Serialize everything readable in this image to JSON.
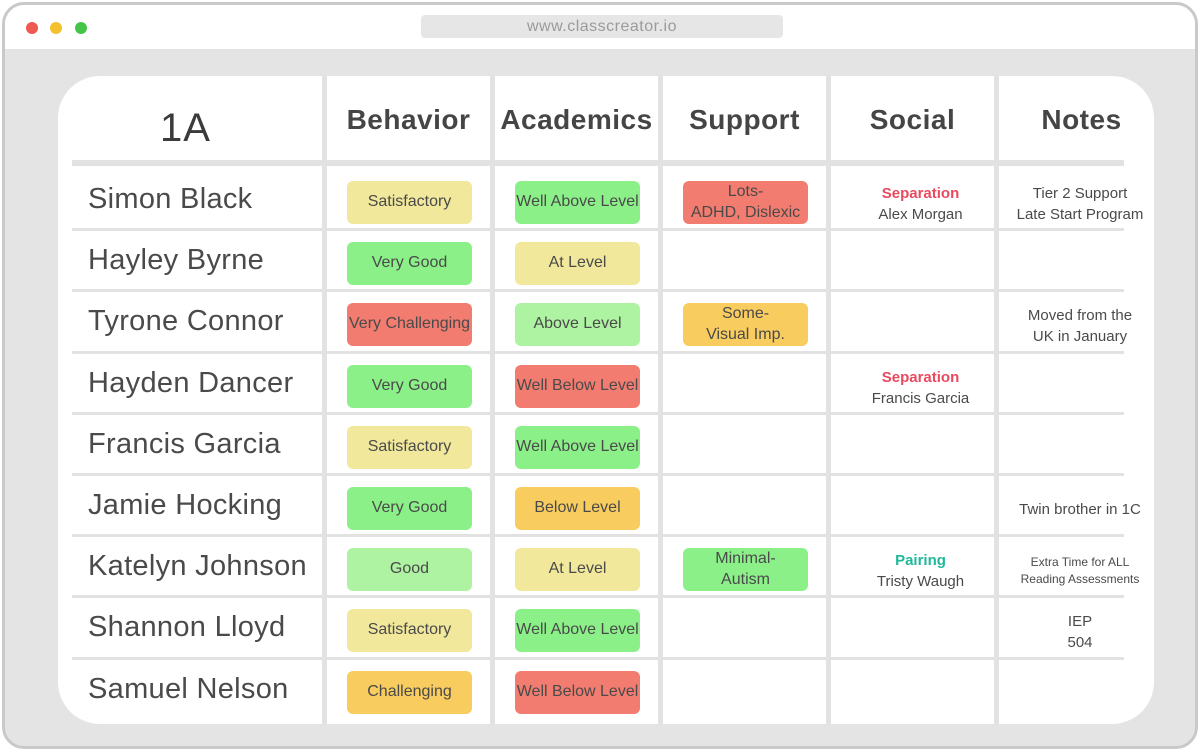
{
  "browser": {
    "url": "www.classcreator.io"
  },
  "colors": {
    "green": "#8bf088",
    "light_green": "#aef3a2",
    "yellow": "#f1e89c",
    "orange": "#f8cc5e",
    "red": "#f27c6f",
    "separation": "#e84a5f",
    "pairing": "#1fb89a"
  },
  "table": {
    "class_name": "1A",
    "headers": {
      "behavior": "Behavior",
      "academics": "Academics",
      "support": "Support",
      "social": "Social",
      "notes": "Notes"
    },
    "rows": [
      {
        "name": "Simon Black",
        "behavior": {
          "label": "Satisfactory",
          "color": "#f1e89c"
        },
        "academics": {
          "label": "Well Above Level",
          "color": "#8bf088"
        },
        "support": {
          "line1": "Lots-",
          "line2": "ADHD, Dislexic",
          "color": "#f27c6f"
        },
        "social": {
          "tag": "Separation",
          "tag_color": "#e84a5f",
          "person": "Alex Morgan"
        },
        "notes": [
          "Tier 2 Support",
          "Late Start Program"
        ]
      },
      {
        "name": "Hayley Byrne",
        "behavior": {
          "label": "Very Good",
          "color": "#8bf088"
        },
        "academics": {
          "label": "At Level",
          "color": "#f1e89c"
        },
        "support": null,
        "social": null,
        "notes": []
      },
      {
        "name": "Tyrone Connor",
        "behavior": {
          "label": "Very Challenging",
          "color": "#f27c6f"
        },
        "academics": {
          "label": "Above Level",
          "color": "#aef3a2"
        },
        "support": {
          "line1": "Some-",
          "line2": "Visual Imp.",
          "color": "#f8cc5e"
        },
        "social": null,
        "notes": [
          "Moved from the",
          "UK in January"
        ]
      },
      {
        "name": "Hayden Dancer",
        "behavior": {
          "label": "Very Good",
          "color": "#8bf088"
        },
        "academics": {
          "label": "Well Below Level",
          "color": "#f27c6f"
        },
        "support": null,
        "social": {
          "tag": "Separation",
          "tag_color": "#e84a5f",
          "person": "Francis Garcia"
        },
        "notes": []
      },
      {
        "name": "Francis Garcia",
        "behavior": {
          "label": "Satisfactory",
          "color": "#f1e89c"
        },
        "academics": {
          "label": "Well Above Level",
          "color": "#8bf088"
        },
        "support": null,
        "social": null,
        "notes": []
      },
      {
        "name": "Jamie Hocking",
        "behavior": {
          "label": "Very Good",
          "color": "#8bf088"
        },
        "academics": {
          "label": "Below Level",
          "color": "#f8cc5e"
        },
        "support": null,
        "social": null,
        "notes": [
          "Twin brother in 1C"
        ]
      },
      {
        "name": "Katelyn Johnson",
        "behavior": {
          "label": "Good",
          "color": "#aef3a2"
        },
        "academics": {
          "label": "At Level",
          "color": "#f1e89c"
        },
        "support": {
          "line1": "Minimal-",
          "line2": "Autism",
          "color": "#8bf088"
        },
        "social": {
          "tag": "Pairing",
          "tag_color": "#1fb89a",
          "person": "Tristy Waugh"
        },
        "notes": [
          "Extra Time for ALL",
          "Reading Assessments"
        ],
        "notes_small": true
      },
      {
        "name": "Shannon Lloyd",
        "behavior": {
          "label": "Satisfactory",
          "color": "#f1e89c"
        },
        "academics": {
          "label": "Well Above Level",
          "color": "#8bf088"
        },
        "support": null,
        "social": null,
        "notes": [
          "IEP",
          "504"
        ]
      },
      {
        "name": "Samuel Nelson",
        "behavior": {
          "label": "Challenging",
          "color": "#f8cc5e"
        },
        "academics": {
          "label": "Well Below Level",
          "color": "#f27c6f"
        },
        "support": null,
        "social": null,
        "notes": []
      }
    ]
  }
}
